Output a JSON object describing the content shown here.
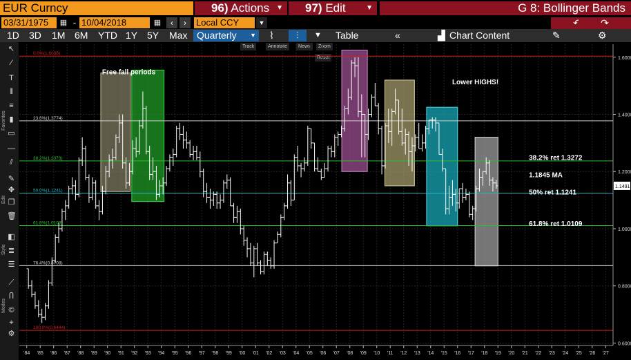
{
  "header": {
    "ticker": "EUR Curncy",
    "actions_num": "96)",
    "actions_label": "Actions",
    "edit_num": "97)",
    "edit_label": "Edit",
    "function_title": "G 8: Bollinger Bands"
  },
  "dates": {
    "start": "03/31/1975",
    "separator": "-",
    "end": "10/04/2018",
    "currency": "Local CCY"
  },
  "toolbar": {
    "ranges": [
      "1D",
      "3D",
      "1M",
      "6M",
      "YTD",
      "1Y",
      "5Y",
      "Max"
    ],
    "frequency": "Quarterly",
    "table_label": "Table",
    "chart_content_label": "Chart Content"
  },
  "mini_toolbar": [
    "Track",
    "Annotate",
    "News",
    "Zoom",
    "Reset"
  ],
  "sidebar_labels": [
    "Favorites",
    "Edit",
    "Style",
    "Modes"
  ],
  "chart_data": {
    "type": "ohlc",
    "title": "",
    "y_ticks": [
      "1.6000",
      "1.4000",
      "1.2000",
      "1.0000",
      "0.8000",
      "0.6000"
    ],
    "ylim": [
      0.59,
      1.67
    ],
    "x_ticks": [
      "'84",
      "'85",
      "'86",
      "'87",
      "'88",
      "'89",
      "'90",
      "'91",
      "'92",
      "'93",
      "'94",
      "'95",
      "'96",
      "'97",
      "'98",
      "'99",
      "'00",
      "'01",
      "'02",
      "'03",
      "'04",
      "'05",
      "'06",
      "'07",
      "'08",
      "'09",
      "'10",
      "'11",
      "'12",
      "'13",
      "'14",
      "'15",
      "'16",
      "'17",
      "'18",
      "'19",
      "'20",
      "'21",
      "'22",
      "'23",
      "'24",
      "'25",
      "'26",
      "'27"
    ],
    "last_price": "1.1491",
    "series_color": "#ffffff",
    "fib_levels": [
      {
        "label": "0.0%(1.6038)",
        "value": 1.6038,
        "color": "#d21e1e"
      },
      {
        "label": "23.6%(1.3774)",
        "value": 1.3774,
        "color": "#cfcfcf"
      },
      {
        "label": "38.2%(1.2373)",
        "value": 1.2373,
        "color": "#2bc02b"
      },
      {
        "label": "50.0%(1.1241)",
        "value": 1.1241,
        "color": "#2ab6c6"
      },
      {
        "label": "61.8%(1.0109)",
        "value": 1.0109,
        "color": "#2bc02b"
      },
      {
        "label": "76.4%(0.8708)",
        "value": 0.8708,
        "color": "#cfcfcf"
      },
      {
        "label": "100.0%(0.6444)",
        "value": 0.6444,
        "color": "#d21e1e"
      }
    ],
    "annotations": [
      {
        "text": "Free fall periods",
        "x": 1989.6,
        "y": 1.54
      },
      {
        "text": "Lower HIGHS!",
        "x": 2015.6,
        "y": 1.505
      },
      {
        "text": "38.2% ret 1.3272",
        "x": 2021.3,
        "y": 1.24
      },
      {
        "text": "1.1845 MA",
        "x": 2021.3,
        "y": 1.18
      },
      {
        "text": "50% ret 1.1241",
        "x": 2021.3,
        "y": 1.12
      },
      {
        "text": "61.8% ret 1.0109",
        "x": 2021.3,
        "y": 1.01
      }
    ],
    "highlights": [
      {
        "x0": 1989.5,
        "x1": 1991.7,
        "y0": 1.13,
        "y1": 1.545,
        "fill": "#7e7a62",
        "stroke": "#c9c39a"
      },
      {
        "x0": 1991.8,
        "x1": 1994.2,
        "y0": 1.095,
        "y1": 1.555,
        "fill": "#1f9a26",
        "stroke": "#49d44f"
      },
      {
        "x0": 2007.4,
        "x1": 2009.3,
        "y0": 1.2,
        "y1": 1.625,
        "fill": "#9a4e8f",
        "stroke": "#d08ac4"
      },
      {
        "x0": 2010.6,
        "x1": 2012.8,
        "y0": 1.15,
        "y1": 1.52,
        "fill": "#a39a6a",
        "stroke": "#d8cf98"
      },
      {
        "x0": 2013.7,
        "x1": 2016.0,
        "y0": 1.01,
        "y1": 1.425,
        "fill": "#17a7b5",
        "stroke": "#4fdbe6"
      },
      {
        "x0": 2017.3,
        "x1": 2019.0,
        "y0": 0.87,
        "y1": 1.32,
        "fill": "#9e9e9e",
        "stroke": "#e0e0e0"
      }
    ],
    "ohlc": [
      [
        1984.0,
        0.86,
        0.86,
        0.79,
        0.8
      ],
      [
        1984.25,
        0.8,
        0.82,
        0.76,
        0.77
      ],
      [
        1984.5,
        0.77,
        0.78,
        0.72,
        0.73
      ],
      [
        1984.75,
        0.73,
        0.75,
        0.69,
        0.7
      ],
      [
        1985.0,
        0.7,
        0.72,
        0.67,
        0.69
      ],
      [
        1985.25,
        0.69,
        0.74,
        0.68,
        0.73
      ],
      [
        1985.5,
        0.73,
        0.82,
        0.72,
        0.81
      ],
      [
        1985.75,
        0.81,
        0.9,
        0.8,
        0.89
      ],
      [
        1986.0,
        0.89,
        0.98,
        0.88,
        0.97
      ],
      [
        1986.25,
        0.97,
        1.02,
        0.95,
        1.0
      ],
      [
        1986.5,
        1.0,
        1.07,
        0.99,
        1.06
      ],
      [
        1986.75,
        1.06,
        1.1,
        1.03,
        1.08
      ],
      [
        1987.0,
        1.08,
        1.15,
        1.07,
        1.14
      ],
      [
        1987.25,
        1.14,
        1.18,
        1.12,
        1.15
      ],
      [
        1987.5,
        1.15,
        1.17,
        1.1,
        1.12
      ],
      [
        1987.75,
        1.12,
        1.25,
        1.11,
        1.24
      ],
      [
        1988.0,
        1.24,
        1.32,
        1.22,
        1.28
      ],
      [
        1988.25,
        1.28,
        1.29,
        1.17,
        1.18
      ],
      [
        1988.5,
        1.18,
        1.19,
        1.09,
        1.11
      ],
      [
        1988.75,
        1.11,
        1.18,
        1.1,
        1.16
      ],
      [
        1989.0,
        1.16,
        1.17,
        1.07,
        1.08
      ],
      [
        1989.25,
        1.08,
        1.1,
        1.03,
        1.06
      ],
      [
        1989.5,
        1.06,
        1.15,
        1.05,
        1.13
      ],
      [
        1989.75,
        1.13,
        1.22,
        1.12,
        1.2
      ],
      [
        1990.0,
        1.2,
        1.26,
        1.18,
        1.24
      ],
      [
        1990.25,
        1.24,
        1.28,
        1.21,
        1.25
      ],
      [
        1990.5,
        1.25,
        1.33,
        1.24,
        1.32
      ],
      [
        1990.75,
        1.32,
        1.4,
        1.3,
        1.37
      ],
      [
        1991.0,
        1.37,
        1.4,
        1.21,
        1.23
      ],
      [
        1991.25,
        1.23,
        1.25,
        1.14,
        1.16
      ],
      [
        1991.5,
        1.16,
        1.23,
        1.15,
        1.2
      ],
      [
        1991.75,
        1.2,
        1.31,
        1.19,
        1.28
      ],
      [
        1992.0,
        1.28,
        1.32,
        1.25,
        1.27
      ],
      [
        1992.25,
        1.27,
        1.38,
        1.26,
        1.36
      ],
      [
        1992.5,
        1.36,
        1.48,
        1.35,
        1.42
      ],
      [
        1992.75,
        1.42,
        1.43,
        1.26,
        1.27
      ],
      [
        1993.0,
        1.27,
        1.29,
        1.17,
        1.19
      ],
      [
        1993.25,
        1.19,
        1.25,
        1.17,
        1.2
      ],
      [
        1993.5,
        1.2,
        1.22,
        1.1,
        1.12
      ],
      [
        1993.75,
        1.12,
        1.17,
        1.11,
        1.15
      ],
      [
        1994.0,
        1.15,
        1.18,
        1.12,
        1.16
      ],
      [
        1994.25,
        1.16,
        1.22,
        1.15,
        1.21
      ],
      [
        1994.5,
        1.21,
        1.26,
        1.2,
        1.25
      ],
      [
        1994.75,
        1.25,
        1.28,
        1.22,
        1.26
      ],
      [
        1995.0,
        1.26,
        1.36,
        1.25,
        1.35
      ],
      [
        1995.25,
        1.35,
        1.37,
        1.31,
        1.33
      ],
      [
        1995.5,
        1.33,
        1.36,
        1.28,
        1.31
      ],
      [
        1995.75,
        1.31,
        1.34,
        1.28,
        1.3
      ],
      [
        1996.0,
        1.3,
        1.31,
        1.25,
        1.26
      ],
      [
        1996.25,
        1.26,
        1.29,
        1.24,
        1.27
      ],
      [
        1996.5,
        1.27,
        1.29,
        1.24,
        1.25
      ],
      [
        1996.75,
        1.25,
        1.27,
        1.18,
        1.2
      ],
      [
        1997.0,
        1.2,
        1.21,
        1.11,
        1.13
      ],
      [
        1997.25,
        1.13,
        1.16,
        1.09,
        1.11
      ],
      [
        1997.5,
        1.11,
        1.14,
        1.07,
        1.1
      ],
      [
        1997.75,
        1.1,
        1.13,
        1.08,
        1.12
      ],
      [
        1998.0,
        1.12,
        1.13,
        1.07,
        1.09
      ],
      [
        1998.25,
        1.09,
        1.12,
        1.07,
        1.1
      ],
      [
        1998.5,
        1.1,
        1.17,
        1.09,
        1.16
      ],
      [
        1998.75,
        1.16,
        1.19,
        1.14,
        1.17
      ],
      [
        1999.0,
        1.17,
        1.18,
        1.08,
        1.08
      ],
      [
        1999.25,
        1.08,
        1.09,
        1.02,
        1.04
      ],
      [
        1999.5,
        1.04,
        1.08,
        1.02,
        1.06
      ],
      [
        1999.75,
        1.06,
        1.07,
        0.98,
        1.0
      ],
      [
        2000.0,
        1.0,
        1.01,
        0.94,
        0.96
      ],
      [
        2000.25,
        0.96,
        0.97,
        0.9,
        0.93
      ],
      [
        2000.5,
        0.93,
        0.95,
        0.87,
        0.88
      ],
      [
        2000.75,
        0.88,
        0.94,
        0.83,
        0.93
      ],
      [
        2001.0,
        0.93,
        0.95,
        0.87,
        0.88
      ],
      [
        2001.25,
        0.88,
        0.89,
        0.84,
        0.85
      ],
      [
        2001.5,
        0.85,
        0.92,
        0.84,
        0.91
      ],
      [
        2001.75,
        0.91,
        0.92,
        0.87,
        0.89
      ],
      [
        2002.0,
        0.89,
        0.9,
        0.86,
        0.87
      ],
      [
        2002.25,
        0.87,
        0.96,
        0.86,
        0.95
      ],
      [
        2002.5,
        0.95,
        0.99,
        0.95,
        0.98
      ],
      [
        2002.75,
        0.98,
        1.05,
        0.97,
        1.04
      ],
      [
        2003.0,
        1.04,
        1.09,
        1.03,
        1.08
      ],
      [
        2003.25,
        1.08,
        1.19,
        1.07,
        1.16
      ],
      [
        2003.5,
        1.16,
        1.17,
        1.08,
        1.1
      ],
      [
        2003.75,
        1.1,
        1.26,
        1.1,
        1.25
      ],
      [
        2004.0,
        1.25,
        1.29,
        1.2,
        1.22
      ],
      [
        2004.25,
        1.22,
        1.23,
        1.18,
        1.21
      ],
      [
        2004.5,
        1.21,
        1.25,
        1.2,
        1.23
      ],
      [
        2004.75,
        1.23,
        1.36,
        1.22,
        1.35
      ],
      [
        2005.0,
        1.35,
        1.35,
        1.28,
        1.3
      ],
      [
        2005.25,
        1.3,
        1.3,
        1.2,
        1.21
      ],
      [
        2005.5,
        1.21,
        1.25,
        1.2,
        1.2
      ],
      [
        2005.75,
        1.2,
        1.21,
        1.17,
        1.18
      ],
      [
        2006.0,
        1.18,
        1.23,
        1.18,
        1.21
      ],
      [
        2006.25,
        1.21,
        1.29,
        1.2,
        1.28
      ],
      [
        2006.5,
        1.28,
        1.29,
        1.25,
        1.27
      ],
      [
        2006.75,
        1.27,
        1.33,
        1.25,
        1.32
      ],
      [
        2007.0,
        1.32,
        1.34,
        1.29,
        1.33
      ],
      [
        2007.25,
        1.33,
        1.36,
        1.32,
        1.35
      ],
      [
        2007.5,
        1.35,
        1.43,
        1.34,
        1.42
      ],
      [
        2007.75,
        1.42,
        1.49,
        1.4,
        1.46
      ],
      [
        2008.0,
        1.46,
        1.59,
        1.45,
        1.58
      ],
      [
        2008.25,
        1.58,
        1.6,
        1.53,
        1.57
      ],
      [
        2008.5,
        1.57,
        1.6,
        1.39,
        1.41
      ],
      [
        2008.75,
        1.41,
        1.47,
        1.25,
        1.4
      ],
      [
        2009.0,
        1.4,
        1.4,
        1.25,
        1.33
      ],
      [
        2009.25,
        1.33,
        1.42,
        1.31,
        1.4
      ],
      [
        2009.5,
        1.4,
        1.47,
        1.39,
        1.46
      ],
      [
        2009.75,
        1.46,
        1.51,
        1.43,
        1.43
      ],
      [
        2010.0,
        1.43,
        1.44,
        1.33,
        1.35
      ],
      [
        2010.25,
        1.35,
        1.36,
        1.19,
        1.22
      ],
      [
        2010.5,
        1.22,
        1.37,
        1.21,
        1.36
      ],
      [
        2010.75,
        1.36,
        1.42,
        1.3,
        1.34
      ],
      [
        2011.0,
        1.34,
        1.42,
        1.29,
        1.41
      ],
      [
        2011.25,
        1.41,
        1.49,
        1.4,
        1.45
      ],
      [
        2011.5,
        1.45,
        1.45,
        1.33,
        1.34
      ],
      [
        2011.75,
        1.34,
        1.42,
        1.29,
        1.3
      ],
      [
        2012.0,
        1.3,
        1.35,
        1.26,
        1.33
      ],
      [
        2012.25,
        1.33,
        1.34,
        1.22,
        1.27
      ],
      [
        2012.5,
        1.27,
        1.32,
        1.2,
        1.29
      ],
      [
        2012.75,
        1.29,
        1.33,
        1.27,
        1.32
      ],
      [
        2013.0,
        1.32,
        1.37,
        1.28,
        1.28
      ],
      [
        2013.25,
        1.28,
        1.33,
        1.27,
        1.3
      ],
      [
        2013.5,
        1.3,
        1.36,
        1.28,
        1.35
      ],
      [
        2013.75,
        1.35,
        1.38,
        1.33,
        1.38
      ],
      [
        2014.0,
        1.38,
        1.39,
        1.35,
        1.38
      ],
      [
        2014.25,
        1.38,
        1.39,
        1.34,
        1.37
      ],
      [
        2014.5,
        1.37,
        1.37,
        1.26,
        1.26
      ],
      [
        2014.75,
        1.26,
        1.28,
        1.2,
        1.21
      ],
      [
        2015.0,
        1.21,
        1.21,
        1.05,
        1.07
      ],
      [
        2015.25,
        1.07,
        1.15,
        1.05,
        1.11
      ],
      [
        2015.5,
        1.11,
        1.17,
        1.08,
        1.12
      ],
      [
        2015.75,
        1.12,
        1.14,
        1.06,
        1.09
      ],
      [
        2016.0,
        1.09,
        1.14,
        1.07,
        1.14
      ],
      [
        2016.25,
        1.14,
        1.16,
        1.09,
        1.11
      ],
      [
        2016.5,
        1.11,
        1.14,
        1.1,
        1.12
      ],
      [
        2016.75,
        1.12,
        1.13,
        1.04,
        1.05
      ],
      [
        2017.0,
        1.05,
        1.08,
        1.03,
        1.07
      ],
      [
        2017.25,
        1.07,
        1.15,
        1.06,
        1.14
      ],
      [
        2017.5,
        1.14,
        1.21,
        1.13,
        1.18
      ],
      [
        2017.75,
        1.18,
        1.2,
        1.15,
        1.2
      ],
      [
        2018.0,
        1.2,
        1.25,
        1.19,
        1.23
      ],
      [
        2018.25,
        1.23,
        1.24,
        1.15,
        1.17
      ],
      [
        2018.5,
        1.17,
        1.18,
        1.13,
        1.16
      ],
      [
        2018.75,
        1.16,
        1.17,
        1.14,
        1.15
      ]
    ]
  }
}
